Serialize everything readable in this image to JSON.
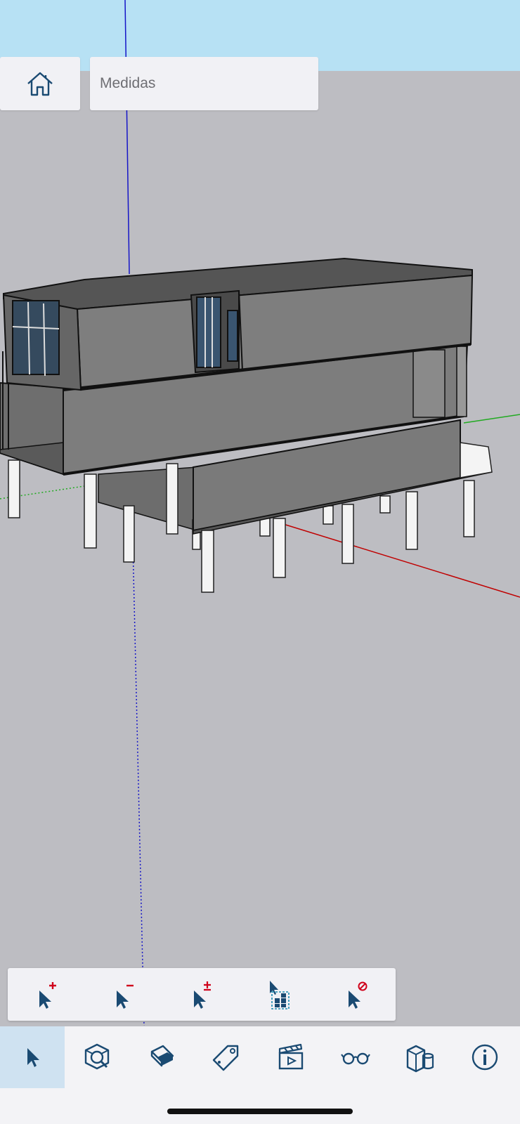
{
  "header": {
    "home_icon": "home-icon",
    "measure_placeholder": "Medidas"
  },
  "selection_toolbar": {
    "items": [
      {
        "name": "select-add-icon",
        "badge": "+"
      },
      {
        "name": "select-subtract-icon",
        "badge": "−"
      },
      {
        "name": "select-toggle-icon",
        "badge": "±"
      },
      {
        "name": "select-all-icon",
        "badge": ""
      },
      {
        "name": "select-none-icon",
        "badge": "⊘"
      }
    ]
  },
  "main_toolbar": {
    "items": [
      {
        "name": "select-tool-icon",
        "active": true
      },
      {
        "name": "orbit-zoom-icon",
        "active": false
      },
      {
        "name": "eraser-icon",
        "active": false
      },
      {
        "name": "tag-icon",
        "active": false
      },
      {
        "name": "scenes-icon",
        "active": false
      },
      {
        "name": "view-glasses-icon",
        "active": false
      },
      {
        "name": "components-icon",
        "active": false
      },
      {
        "name": "info-icon",
        "active": false
      }
    ]
  },
  "colors": {
    "sky": "#b7e1f4",
    "ground": "#bdbdc2",
    "accent": "#1a4a72",
    "badge": "#d0021b",
    "active_tool": "#cfe2f1",
    "axis_red": "#c00000",
    "axis_green": "#22aa22",
    "axis_blue": "#1515c8"
  }
}
